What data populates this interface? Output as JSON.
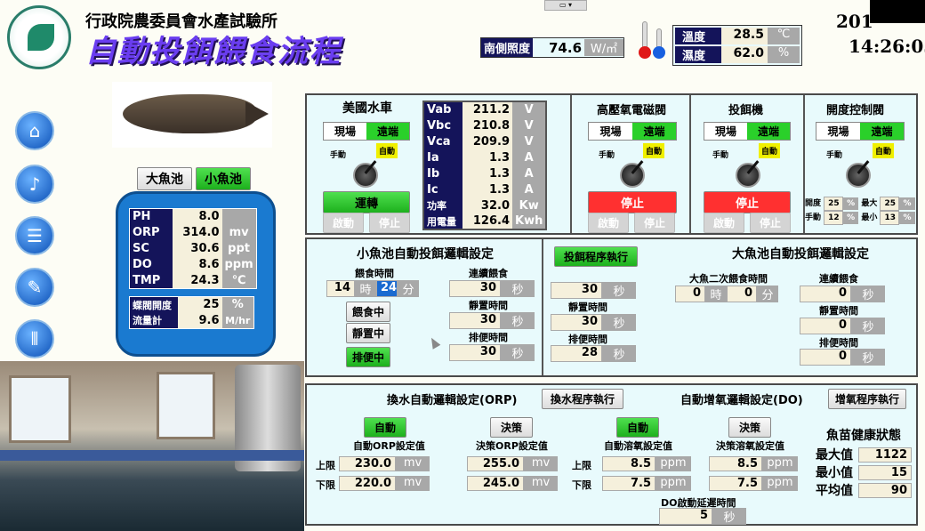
{
  "header": {
    "org": "行政院農委員會水產試驗所",
    "title": "自動投餌餵食流程",
    "date": "201",
    "time": "14:26:03",
    "sunlight": {
      "label": "南側照度",
      "value": "74.6",
      "unit": "W/㎡"
    },
    "temp": {
      "label": "溫度",
      "value": "28.5",
      "unit": "℃"
    },
    "humidity": {
      "label": "濕度",
      "value": "62.0",
      "unit": "%"
    }
  },
  "pond_tabs": {
    "big": "大魚池",
    "small": "小魚池"
  },
  "sensors": [
    {
      "name": "PH",
      "value": "8.0",
      "unit": ""
    },
    {
      "name": "ORP",
      "value": "314.0",
      "unit": "mv"
    },
    {
      "name": "SC",
      "value": "30.6",
      "unit": "ppt"
    },
    {
      "name": "DO",
      "value": "8.6",
      "unit": "ppm"
    },
    {
      "name": "TMP",
      "value": "24.3",
      "unit": "℃"
    }
  ],
  "valve": {
    "label": "蝶閥開度",
    "value": "25",
    "unit": "%"
  },
  "flow": {
    "label": "流量計",
    "value": "9.6",
    "unit": "M/hr"
  },
  "common": {
    "local": "現場",
    "remote": "遠端",
    "manual": "手動",
    "auto": "自動",
    "start": "啟動",
    "stop_btn": "停止"
  },
  "waterwheel": {
    "title": "美國水車",
    "status": "運轉"
  },
  "electric": [
    {
      "name": "Vab",
      "value": "211.2",
      "unit": "V"
    },
    {
      "name": "Vbc",
      "value": "210.8",
      "unit": "V"
    },
    {
      "name": "Vca",
      "value": "209.9",
      "unit": "V"
    },
    {
      "name": "Ia",
      "value": "1.3",
      "unit": "A"
    },
    {
      "name": "Ib",
      "value": "1.3",
      "unit": "A"
    },
    {
      "name": "Ic",
      "value": "1.3",
      "unit": "A"
    },
    {
      "name": "功率",
      "value": "32.0",
      "unit": "Kw"
    },
    {
      "name": "用電量",
      "value": "126.4",
      "unit": "Kwh"
    }
  ],
  "oxyvalve": {
    "title": "高壓氧電磁閥",
    "status": "停止"
  },
  "feeder": {
    "title": "投餌機",
    "status": "停止"
  },
  "opening": {
    "title": "開度控制閥",
    "open": "開度",
    "open_v": "25",
    "max": "最大",
    "max_v": "25",
    "manual": "手動",
    "manual_v": "12",
    "min": "最小",
    "min_v": "13",
    "pct": "%"
  },
  "small_pond": {
    "title": "小魚池自動投餌邏輯設定",
    "feed_time": "餵食時間",
    "hour": "14",
    "hour_u": "時",
    "minute": "24",
    "minute_u": "分",
    "cont_feed": "連續餵食",
    "cont_feed_v": "30",
    "sec": "秒",
    "feeding": "餵食中",
    "resting": "靜置中",
    "draining": "排便中",
    "rest_time": "靜置時間",
    "rest_v": "30",
    "drain_time": "排便時間",
    "drain_v": "30"
  },
  "feed_prog": {
    "btn": "投餌程序執行",
    "v1": "30",
    "rest_time": "靜置時間",
    "v2": "30",
    "drain_time": "排便時間",
    "v3": "28"
  },
  "big_pond": {
    "title": "大魚池自動投餌邏輯設定",
    "second_time": "大魚二次餵食時間",
    "hour": "0",
    "minute": "0",
    "cont_feed": "連續餵食",
    "cont_v": "0",
    "rest_time": "靜置時間",
    "rest_v": "0",
    "drain_time": "排便時間",
    "drain_v": "0"
  },
  "orp_panel": {
    "title": "換水自動邏輯設定(ORP)",
    "btn": "換水程序執行",
    "auto": "自動",
    "decide": "決策",
    "auto_set": "自動ORP設定值",
    "decide_set": "決策ORP設定值",
    "upper": "上限",
    "lower": "下限",
    "up_v": "230.0",
    "low_v": "220.0",
    "dup_v": "255.0",
    "dlow_v": "245.0",
    "unit": "mv"
  },
  "do_panel": {
    "title": "自動增氧邏輯設定(DO)",
    "btn": "增氧程序執行",
    "auto": "自動",
    "decide": "決策",
    "auto_set": "自動溶氧設定值",
    "decide_set": "決策溶氧設定值",
    "upper": "上限",
    "lower": "下限",
    "up_v": "8.5",
    "low_v": "7.5",
    "dup_v": "8.5",
    "dlow_v": "7.5",
    "unit": "ppm",
    "delay": "DO啟動延遲時間",
    "delay_v": "5",
    "sec": "秒"
  },
  "health": {
    "title": "魚苗健康狀態",
    "max": "最大值",
    "max_v": "1122",
    "min": "最小值",
    "min_v": "15",
    "avg": "平均值",
    "avg_v": "90"
  }
}
